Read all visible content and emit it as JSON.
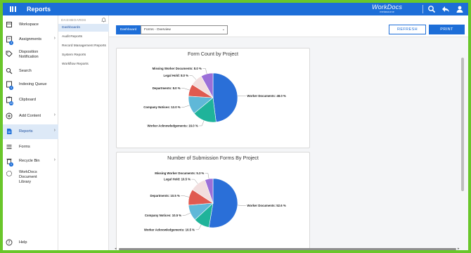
{
  "header": {
    "title": "Reports",
    "brand_name": "WorkDocs",
    "brand_tagline": "metasource",
    "icons": [
      "menu-icon",
      "search-icon",
      "reply-icon",
      "user-icon"
    ]
  },
  "sidebar": {
    "items": [
      {
        "label": "Workspace",
        "icon": "workspace-icon",
        "badge": null,
        "chevron": false
      },
      {
        "label": "Assignments",
        "icon": "assignments-icon",
        "badge": "3",
        "chevron": true
      },
      {
        "label": "Disposition Notification",
        "icon": "tag-icon",
        "badge": null,
        "chevron": false
      },
      {
        "label": "Search",
        "icon": "search-icon",
        "badge": null,
        "chevron": false
      },
      {
        "label": "Indexing Queue",
        "icon": "indexing-queue-icon",
        "badge": "4",
        "chevron": false
      },
      {
        "label": "Clipboard",
        "icon": "clipboard-icon",
        "badge": "10",
        "chevron": false
      },
      {
        "label": "Add Content",
        "icon": "add-icon",
        "badge": null,
        "chevron": true
      },
      {
        "label": "Reports",
        "icon": "report-icon",
        "badge": null,
        "chevron": true,
        "active": true
      },
      {
        "label": "Forms",
        "icon": "forms-icon",
        "badge": null,
        "chevron": false
      },
      {
        "label": "Recycle Bin",
        "icon": "trash-icon",
        "badge": "1",
        "chevron": true
      },
      {
        "label": "WorkDocs Document Library",
        "icon": "library-icon",
        "badge": null,
        "chevron": false
      }
    ],
    "help_label": "Help"
  },
  "subnav": {
    "heading": "DASHBOARDS",
    "items": [
      "Dashboards",
      "Audit Reports",
      "Record Management Reports",
      "System Reports",
      "Workflow Reports"
    ]
  },
  "controls": {
    "dashboard_label": "Dashboard",
    "selected_form": "Forms - Overview",
    "refresh_label": "REFRESH",
    "print_label": "PRINT"
  },
  "colors": {
    "accent": "#1d6ed8",
    "slices": [
      "#2a6fd8",
      "#1fb39a",
      "#5fb8d8",
      "#e05a50",
      "#f2dede",
      "#9b6fd8"
    ]
  },
  "chart_data": [
    {
      "type": "pie",
      "title": "Form Count by Project",
      "categories": [
        "Worker Documents",
        "Worker Acknowledgements",
        "Company Notices",
        "Departments",
        "Legal Hold",
        "Missing Worker Documents"
      ],
      "values": [
        48.0,
        16.0,
        12.0,
        8.0,
        8.0,
        8.0
      ],
      "labels": [
        "Worker Documents: 48.0 %",
        "Worker Acknowledgements: 16.0 %",
        "Company Notices: 12.0 %",
        "Departments: 8.0 %",
        "Legal Hold: 8.0 %",
        "Missing Worker Documents: 8.0 %"
      ]
    },
    {
      "type": "pie",
      "title": "Number of Submission Forms By Project",
      "categories": [
        "Worker Documents",
        "Worker Acknowledgements",
        "Company Notices",
        "Departments",
        "Legal Hold",
        "Missing Worker Documents"
      ],
      "values": [
        52.6,
        10.5,
        10.5,
        10.5,
        10.5,
        5.3
      ],
      "labels": [
        "Worker Documents: 52.6 %",
        "Worker Acknowledgements: 10.5 %",
        "Company Notices: 10.5 %",
        "Departments: 10.5 %",
        "Legal Hold: 10.5 %",
        "Missing Worker Documents: 5.3 %"
      ]
    }
  ]
}
